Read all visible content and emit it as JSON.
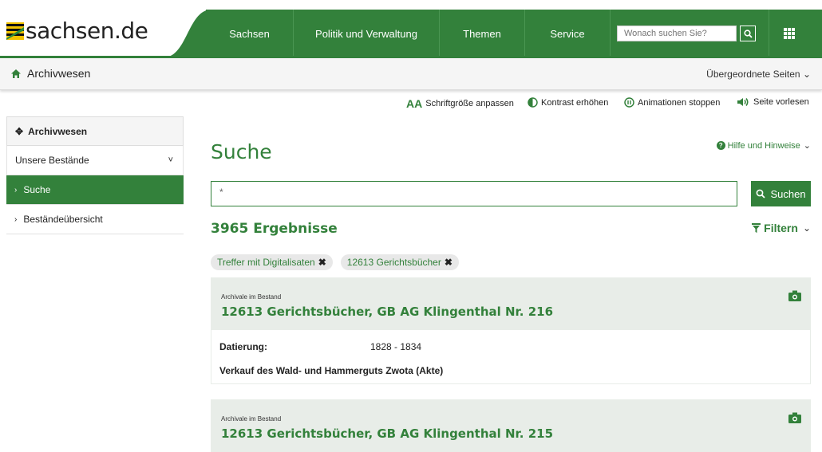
{
  "header": {
    "logo_text": "sachsen.de",
    "nav": [
      "Sachsen",
      "Politik und Verwaltung",
      "Themen",
      "Service"
    ],
    "search_placeholder": "Wonach suchen Sie?"
  },
  "subbar": {
    "home_label": "Archivwesen",
    "upper_pages": "Übergeordnete Seiten"
  },
  "tools": {
    "font_size": "Schriftgröße anpassen",
    "contrast": "Kontrast erhöhen",
    "animations": "Animationen stoppen",
    "read_aloud": "Seite vorlesen"
  },
  "sidebar": {
    "items": [
      {
        "label": "Archivwesen"
      },
      {
        "label": "Unsere Bestände"
      },
      {
        "label": "Suche"
      },
      {
        "label": "Beständeübersicht"
      }
    ]
  },
  "main": {
    "title": "Suche",
    "help": "Hilfe und Hinweise",
    "search_value": "*",
    "search_button": "Suchen",
    "result_count": "3965 Ergebnisse",
    "filter": "Filtern",
    "chips": [
      "Treffer mit Digitalisaten",
      "12613 Gerichtsbücher"
    ],
    "results": [
      {
        "kicker": "Archivale im Bestand",
        "title": "12613 Gerichtsbücher, GB AG Klingenthal Nr. 216",
        "date_label": "Datierung:",
        "date": "1828 - 1834",
        "description": "Verkauf des Wald- und Hammerguts Zwota (Akte)"
      },
      {
        "kicker": "Archivale im Bestand",
        "title": "12613 Gerichtsbücher, GB AG Klingenthal Nr. 215"
      }
    ]
  },
  "colors": {
    "brand_green": "#33813b"
  }
}
